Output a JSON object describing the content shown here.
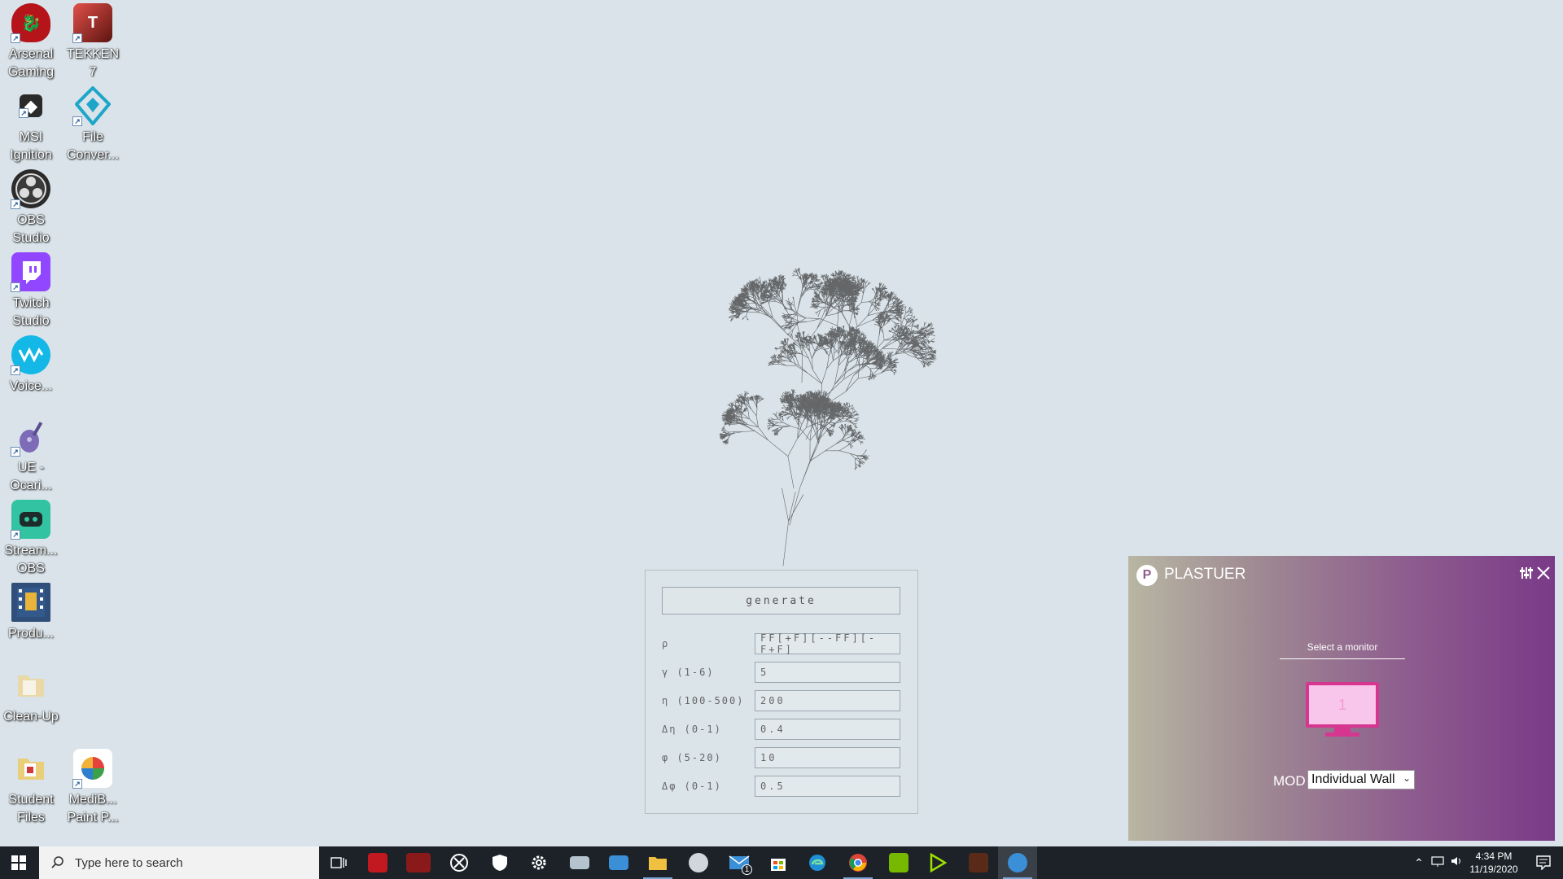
{
  "desktop": {
    "icons": [
      {
        "label": "Arsenal\nGaming",
        "icon": "msi-dragon-icon"
      },
      {
        "label": "TEKKEN\n7",
        "icon": "tekken-icon"
      },
      {
        "label": "MSI\nIgnition",
        "icon": "msi-shield-icon"
      },
      {
        "label": "File\nConver...",
        "icon": "diamond-icon"
      },
      {
        "label": "OBS\nStudio",
        "icon": "obs-icon"
      },
      {
        "label": "Twitch\nStudio",
        "icon": "twitch-icon"
      },
      {
        "label": "Voice...",
        "icon": "voicemod-icon"
      },
      {
        "label": "UE -\nOcari...",
        "icon": "ocarina-icon"
      },
      {
        "label": "Stream...\nOBS",
        "icon": "streamlabs-icon"
      },
      {
        "label": "Produ...",
        "icon": "film-icon"
      },
      {
        "label": "Clean-Up",
        "icon": "folder-icon"
      },
      {
        "label": "Student\nFiles",
        "icon": "folder-icon"
      },
      {
        "label": "MediB...\nPaint P...",
        "icon": "medibang-icon"
      }
    ]
  },
  "panel": {
    "generate_label": "generate",
    "rows": [
      {
        "label": "ρ",
        "value": "FF[+F][--FF][-F+F]"
      },
      {
        "label": "γ (1-6)",
        "value": "5"
      },
      {
        "label": "η (100-500)",
        "value": "200"
      },
      {
        "label": "Δη (0-1)",
        "value": "0.4"
      },
      {
        "label": "φ (5-20)",
        "value": "10"
      },
      {
        "label": "Δφ (0-1)",
        "value": "0.5"
      }
    ]
  },
  "plastuer": {
    "title": "PLASTUER",
    "logo_letter": "P",
    "select_monitor": "Select a monitor",
    "monitor_number": "1",
    "mode_label": "MOD",
    "mode_value": "Individual Wall",
    "accent": "#d6368f"
  },
  "taskbar": {
    "search_placeholder": "Type here to search",
    "mail_badge": "1",
    "time": "4:34 PM",
    "date": "11/19/2020"
  },
  "colors": {
    "desktop_bg": "#d9e3e9",
    "taskbar_bg": "#1c2228"
  }
}
